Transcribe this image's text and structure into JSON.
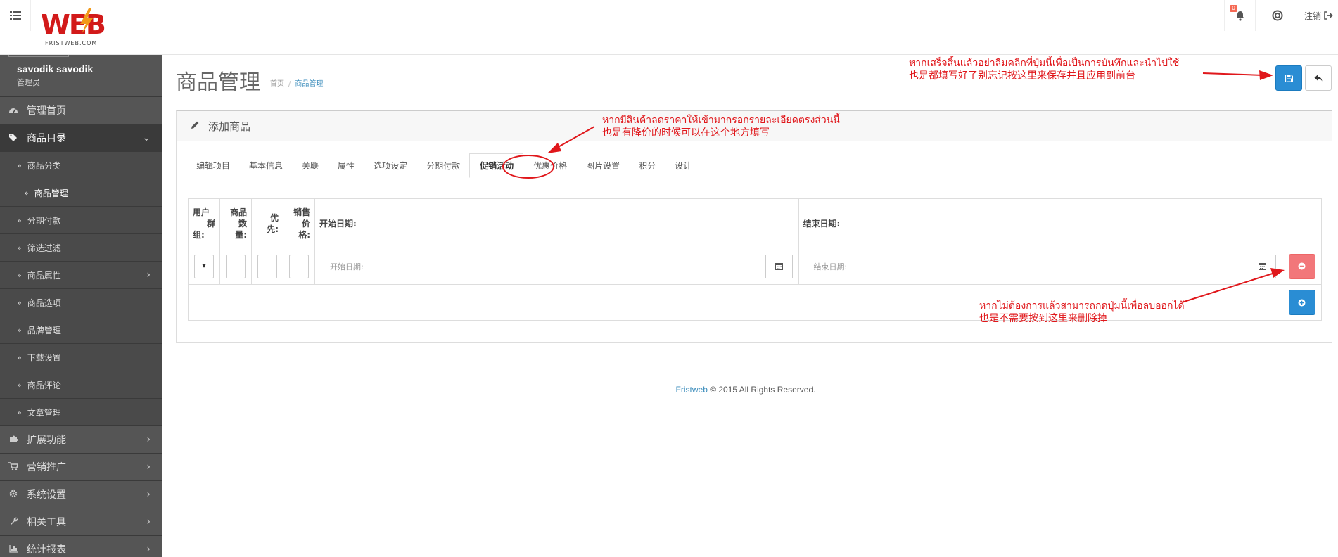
{
  "header": {
    "logo_text": "WEB",
    "logo_subtext": "FRISTWEB.COM",
    "notification_count": "0",
    "logout_label": "注销"
  },
  "sidebar": {
    "user_name": "savodik savodik",
    "user_role": "管理员",
    "items": [
      {
        "label": "管理首页",
        "icon": "dashboard-icon"
      },
      {
        "label": "商品目录",
        "icon": "tags-icon",
        "active": true
      },
      {
        "label": "扩展功能",
        "icon": "puzzle-icon"
      },
      {
        "label": "营销推广",
        "icon": "cart-icon"
      },
      {
        "label": "系统设置",
        "icon": "gear-icon"
      },
      {
        "label": "相关工具",
        "icon": "wrench-icon"
      },
      {
        "label": "统计报表",
        "icon": "bar-chart-icon"
      }
    ],
    "sub_items": [
      {
        "label": "商品分类"
      },
      {
        "label": "商品管理",
        "active": true
      },
      {
        "label": "分期付款"
      },
      {
        "label": "筛选过滤"
      },
      {
        "label": "商品属性"
      },
      {
        "label": "商品选项"
      },
      {
        "label": "品牌管理"
      },
      {
        "label": "下载设置"
      },
      {
        "label": "商品评论"
      },
      {
        "label": "文章管理"
      }
    ]
  },
  "page": {
    "title": "商品管理",
    "breadcrumb_home": "首页",
    "breadcrumb_current": "商品管理"
  },
  "panel": {
    "heading": "添加商品",
    "tabs": [
      "编辑项目",
      "基本信息",
      "关联",
      "属性",
      "选项设定",
      "分期付款",
      "促销活动",
      "优惠价格",
      "图片设置",
      "积分",
      "设计"
    ],
    "active_tab": "促销活动"
  },
  "table": {
    "col_customer_group": [
      "用户",
      "群",
      "组:"
    ],
    "col_quantity": [
      "商品",
      "数",
      "量:"
    ],
    "col_priority": [
      "优",
      "先:"
    ],
    "col_price": [
      "销售",
      "价",
      "格:"
    ],
    "col_start_date": "开始日期:",
    "col_end_date": "结束日期:",
    "start_placeholder": "开始日期:",
    "end_placeholder": "结束日期:",
    "select_value": "▾"
  },
  "footer": {
    "brand": "Fristweb",
    "rights": " © 2015 All Rights Reserved."
  },
  "annotations": {
    "save_note_line1": "หากเสร็จสิ้นแล้วอย่าลืมคลิกที่ปุ่มนี้เพื่อเป็นการบันทึกและนำไปใช้",
    "save_note_line2": "也是都填写好了别忘记按这里来保存并且应用到前台",
    "tab_note_line1": "หากมีสินค้าลดราคาให้เข้ามากรอกรายละเอียดตรงส่วนนี้",
    "tab_note_line2": "也是有降价的时候可以在这个地方填写",
    "remove_note_line1": "หากไม่ต้องการแล้วสามารถกดปุ่มนี้เพื่อลบออกได้",
    "remove_note_line2": "也是不需要按到这里来删除掉"
  },
  "colors": {
    "primary": "#2a8dd4",
    "danger": "#f2777a",
    "annotation": "#e0171b",
    "sidebar_bg": "#444444",
    "link": "#3c8dbc"
  }
}
